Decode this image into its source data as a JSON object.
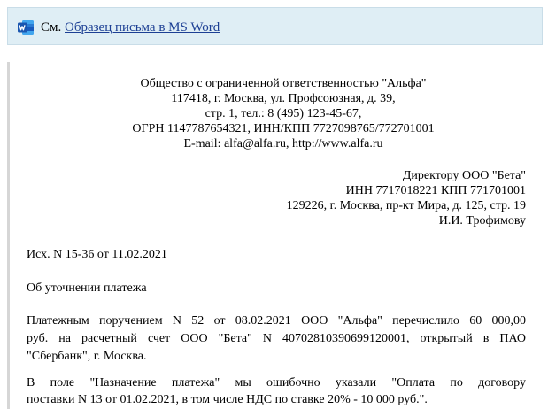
{
  "see_bar": {
    "prefix": "См.",
    "link_text": "Образец письма в MS Word",
    "icon": "word-document-icon"
  },
  "sender": {
    "line1": "Общество с ограниченной ответственностью \"Альфа\"",
    "line2": "117418, г. Москва, ул. Профсоюзная, д. 39,",
    "line3": "стр. 1, тел.: 8 (495) 123-45-67,",
    "line4": "ОГРН 1147787654321, ИНН/КПП 7727098765/772701001",
    "line5": "E-mail: alfa@alfa.ru, http://www.alfa.ru"
  },
  "recipient": {
    "line1": "Директору ООО \"Бета\"",
    "line2": "ИНН 7717018221 КПП 771701001",
    "line3": "129226, г. Москва, пр-кт Мира, д. 125, стр. 19",
    "line4": "И.И. Трофимову"
  },
  "outgoing_ref": "Исх. N 15-36 от 11.02.2021",
  "subject": "Об уточнении платежа",
  "paragraph1": {
    "line1": "Платежным поручением N 52 от 08.02.2021 ООО \"Альфа\" перечислило 60 000,00",
    "line2": "руб. на расчетный счет ООО \"Бета\" N 40702810390699120001, открытый в ПАО",
    "line3": "\"Сбербанк\", г. Москва."
  },
  "paragraph2": {
    "line1": "В поле \"Назначение платежа\" мы ошибочно указали \"Оплата по договору",
    "line2": "поставки N 13 от 01.02.2021, в том числе НДС по ставке 20% - 10 000 руб.\"."
  }
}
